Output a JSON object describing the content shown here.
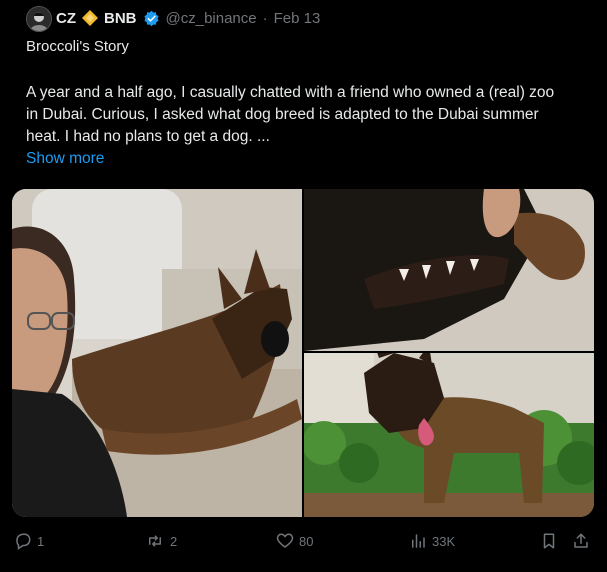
{
  "tweet": {
    "author_name": "CZ",
    "author_handle": "@cz_binance",
    "separator": "·",
    "date": "Feb 13",
    "name_suffix": "BNB",
    "title": "Broccoli's Story",
    "body": "A year and a half ago, I casually chatted with a friend who owned a (real) zoo in Dubai. Curious, I asked what dog breed is adapted to the Dubai summer heat. I had no plans to get a dog. ...",
    "show_more_label": "Show more"
  },
  "media": {
    "photos": [
      {
        "name": "photo-man-with-dog",
        "description": "Man with glasses lying next to a dog on a couch"
      },
      {
        "name": "photo-dog-teeth",
        "description": "Close-up of a dog's teeth"
      },
      {
        "name": "photo-dog-garden",
        "description": "Dog standing in a garden"
      }
    ]
  },
  "actions": {
    "replies": "1",
    "reposts": "2",
    "likes": "80",
    "views": "33K"
  },
  "colors": {
    "background": "#000000",
    "text": "#e7e9ea",
    "muted": "#71767b",
    "link": "#1d9bf0",
    "verified": "#1d9bf0",
    "bnb": "#f3ba2f"
  },
  "icons": [
    "avatar",
    "bnb-icon",
    "verified-icon",
    "reply-icon",
    "repost-icon",
    "like-icon",
    "views-icon",
    "bookmark-icon",
    "share-icon"
  ]
}
